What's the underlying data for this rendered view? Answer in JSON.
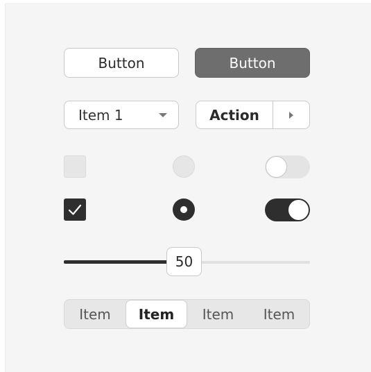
{
  "buttons": {
    "secondary_label": "Button",
    "primary_label": "Button"
  },
  "dropdown": {
    "selected": "Item 1"
  },
  "split_button": {
    "label": "Action"
  },
  "checkbox_unchecked": {
    "checked": false
  },
  "radio_unselected": {
    "selected": false
  },
  "toggle_off": {
    "on": false
  },
  "checkbox_checked": {
    "checked": true
  },
  "radio_selected": {
    "selected": true
  },
  "toggle_on": {
    "on": true
  },
  "slider": {
    "value": "50",
    "min": 0,
    "max": 100
  },
  "segmented": {
    "items": [
      "Item",
      "Item",
      "Item",
      "Item"
    ],
    "active_index": 1
  },
  "colors": {
    "panel_bg": "#f5f5f5",
    "dark": "#2e2e2e",
    "primary_button": "#6e6e6e",
    "border": "#c9c9c9"
  }
}
